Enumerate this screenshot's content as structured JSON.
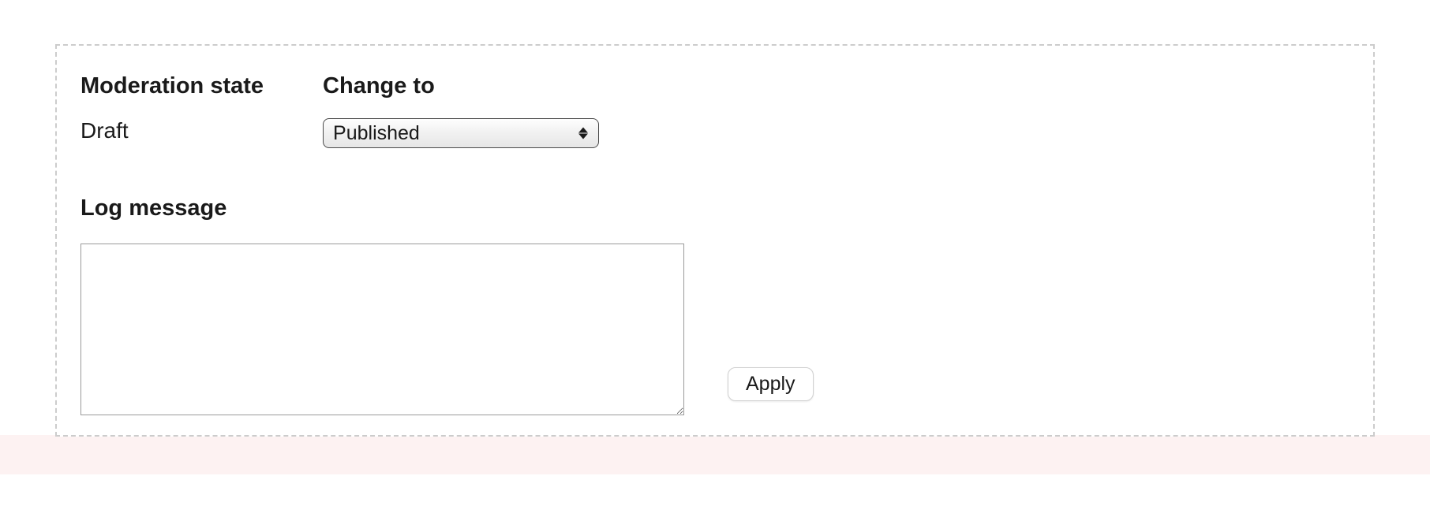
{
  "moderation": {
    "state_label": "Moderation state",
    "state_value": "Draft",
    "change_to_label": "Change to",
    "selected_option": "Published"
  },
  "log": {
    "label": "Log message",
    "value": ""
  },
  "actions": {
    "apply_label": "Apply"
  }
}
